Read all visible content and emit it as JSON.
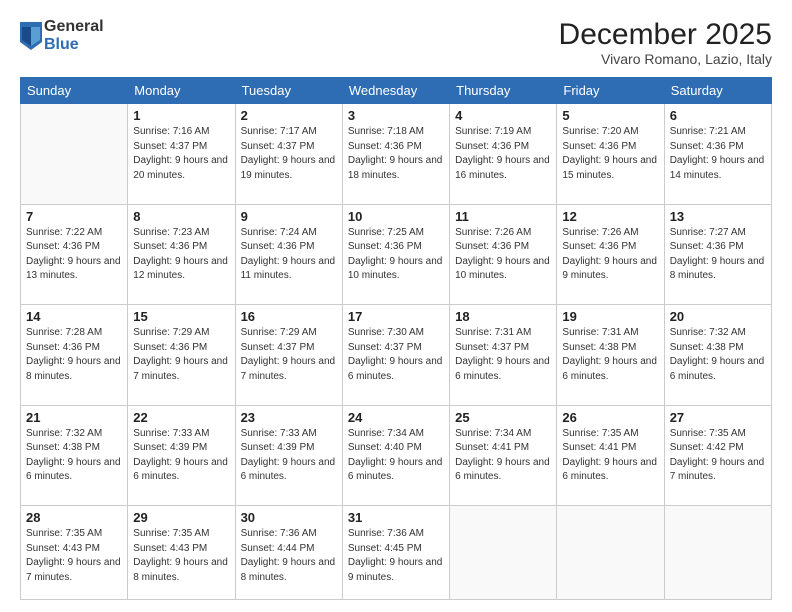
{
  "logo": {
    "general": "General",
    "blue": "Blue"
  },
  "header": {
    "month": "December 2025",
    "location": "Vivaro Romano, Lazio, Italy"
  },
  "weekdays": [
    "Sunday",
    "Monday",
    "Tuesday",
    "Wednesday",
    "Thursday",
    "Friday",
    "Saturday"
  ],
  "weeks": [
    [
      {
        "num": "",
        "empty": true
      },
      {
        "num": "1",
        "sunrise": "7:16 AM",
        "sunset": "4:37 PM",
        "daylight": "9 hours and 20 minutes."
      },
      {
        "num": "2",
        "sunrise": "7:17 AM",
        "sunset": "4:37 PM",
        "daylight": "9 hours and 19 minutes."
      },
      {
        "num": "3",
        "sunrise": "7:18 AM",
        "sunset": "4:36 PM",
        "daylight": "9 hours and 18 minutes."
      },
      {
        "num": "4",
        "sunrise": "7:19 AM",
        "sunset": "4:36 PM",
        "daylight": "9 hours and 16 minutes."
      },
      {
        "num": "5",
        "sunrise": "7:20 AM",
        "sunset": "4:36 PM",
        "daylight": "9 hours and 15 minutes."
      },
      {
        "num": "6",
        "sunrise": "7:21 AM",
        "sunset": "4:36 PM",
        "daylight": "9 hours and 14 minutes."
      }
    ],
    [
      {
        "num": "7",
        "sunrise": "7:22 AM",
        "sunset": "4:36 PM",
        "daylight": "9 hours and 13 minutes."
      },
      {
        "num": "8",
        "sunrise": "7:23 AM",
        "sunset": "4:36 PM",
        "daylight": "9 hours and 12 minutes."
      },
      {
        "num": "9",
        "sunrise": "7:24 AM",
        "sunset": "4:36 PM",
        "daylight": "9 hours and 11 minutes."
      },
      {
        "num": "10",
        "sunrise": "7:25 AM",
        "sunset": "4:36 PM",
        "daylight": "9 hours and 10 minutes."
      },
      {
        "num": "11",
        "sunrise": "7:26 AM",
        "sunset": "4:36 PM",
        "daylight": "9 hours and 10 minutes."
      },
      {
        "num": "12",
        "sunrise": "7:26 AM",
        "sunset": "4:36 PM",
        "daylight": "9 hours and 9 minutes."
      },
      {
        "num": "13",
        "sunrise": "7:27 AM",
        "sunset": "4:36 PM",
        "daylight": "9 hours and 8 minutes."
      }
    ],
    [
      {
        "num": "14",
        "sunrise": "7:28 AM",
        "sunset": "4:36 PM",
        "daylight": "9 hours and 8 minutes."
      },
      {
        "num": "15",
        "sunrise": "7:29 AM",
        "sunset": "4:36 PM",
        "daylight": "9 hours and 7 minutes."
      },
      {
        "num": "16",
        "sunrise": "7:29 AM",
        "sunset": "4:37 PM",
        "daylight": "9 hours and 7 minutes."
      },
      {
        "num": "17",
        "sunrise": "7:30 AM",
        "sunset": "4:37 PM",
        "daylight": "9 hours and 6 minutes."
      },
      {
        "num": "18",
        "sunrise": "7:31 AM",
        "sunset": "4:37 PM",
        "daylight": "9 hours and 6 minutes."
      },
      {
        "num": "19",
        "sunrise": "7:31 AM",
        "sunset": "4:38 PM",
        "daylight": "9 hours and 6 minutes."
      },
      {
        "num": "20",
        "sunrise": "7:32 AM",
        "sunset": "4:38 PM",
        "daylight": "9 hours and 6 minutes."
      }
    ],
    [
      {
        "num": "21",
        "sunrise": "7:32 AM",
        "sunset": "4:38 PM",
        "daylight": "9 hours and 6 minutes."
      },
      {
        "num": "22",
        "sunrise": "7:33 AM",
        "sunset": "4:39 PM",
        "daylight": "9 hours and 6 minutes."
      },
      {
        "num": "23",
        "sunrise": "7:33 AM",
        "sunset": "4:39 PM",
        "daylight": "9 hours and 6 minutes."
      },
      {
        "num": "24",
        "sunrise": "7:34 AM",
        "sunset": "4:40 PM",
        "daylight": "9 hours and 6 minutes."
      },
      {
        "num": "25",
        "sunrise": "7:34 AM",
        "sunset": "4:41 PM",
        "daylight": "9 hours and 6 minutes."
      },
      {
        "num": "26",
        "sunrise": "7:35 AM",
        "sunset": "4:41 PM",
        "daylight": "9 hours and 6 minutes."
      },
      {
        "num": "27",
        "sunrise": "7:35 AM",
        "sunset": "4:42 PM",
        "daylight": "9 hours and 7 minutes."
      }
    ],
    [
      {
        "num": "28",
        "sunrise": "7:35 AM",
        "sunset": "4:43 PM",
        "daylight": "9 hours and 7 minutes."
      },
      {
        "num": "29",
        "sunrise": "7:35 AM",
        "sunset": "4:43 PM",
        "daylight": "9 hours and 8 minutes."
      },
      {
        "num": "30",
        "sunrise": "7:36 AM",
        "sunset": "4:44 PM",
        "daylight": "9 hours and 8 minutes."
      },
      {
        "num": "31",
        "sunrise": "7:36 AM",
        "sunset": "4:45 PM",
        "daylight": "9 hours and 9 minutes."
      },
      {
        "num": "",
        "empty": true
      },
      {
        "num": "",
        "empty": true
      },
      {
        "num": "",
        "empty": true
      }
    ]
  ]
}
